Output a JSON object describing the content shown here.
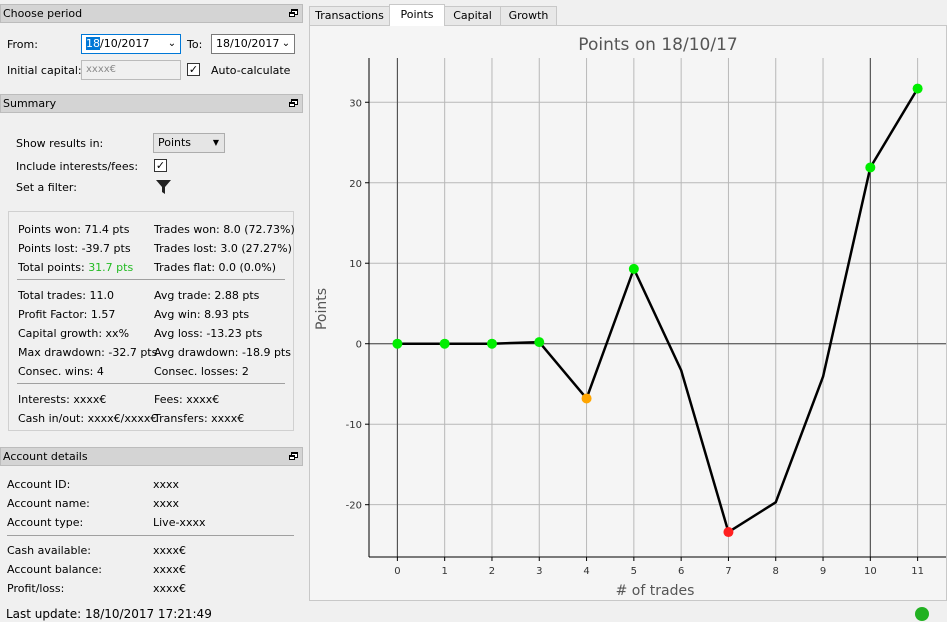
{
  "period": {
    "header": "Choose period",
    "from_label": "From:",
    "from_day": "18",
    "from_rest": "/10/2017",
    "to_label": "To:",
    "to_value": "18/10/2017",
    "capital_label": "Initial capital:",
    "capital_placeholder": "xxxx€",
    "autocalc_label": "Auto-calculate"
  },
  "summary": {
    "header": "Summary",
    "show_results_label": "Show results in:",
    "show_results_value": "Points",
    "include_fees_label": "Include interests/fees:",
    "filter_label": "Set a filter:",
    "stats": {
      "points_won": "Points won: 71.4 pts",
      "trades_won": "Trades won: 8.0 (72.73%)",
      "points_lost": "Points lost: -39.7 pts",
      "trades_lost": "Trades lost: 3.0 (27.27%)",
      "total_points_label": "Total points: ",
      "total_points_value": "31.7 pts",
      "trades_flat": "Trades flat: 0.0 (0.0%)",
      "total_trades": "Total trades: 11.0",
      "avg_trade": "Avg trade: 2.88 pts",
      "profit_factor": "Profit Factor: 1.57",
      "avg_win": "Avg win: 8.93 pts",
      "capital_growth": "Capital growth: xx%",
      "avg_loss": "Avg loss: -13.23 pts",
      "max_drawdown": "Max drawdown: -32.7 pts",
      "avg_drawdown": "Avg drawdown: -18.9 pts",
      "consec_wins": "Consec. wins: 4",
      "consec_losses": "Consec. losses: 2",
      "interests": "Interests: xxxx€",
      "fees": "Fees: xxxx€",
      "cash_inout": "Cash in/out: xxxx€/xxxx€",
      "transfers": "Transfers: xxxx€"
    },
    "total_points_color": "#22bb22"
  },
  "account": {
    "header": "Account details",
    "id_label": "Account ID:",
    "id_value": "xxxx",
    "name_label": "Account name:",
    "name_value": "xxxx",
    "type_label": "Account type:",
    "type_value": "Live-xxxx",
    "cash_label": "Cash available:",
    "cash_value": "xxxx€",
    "balance_label": "Account balance:",
    "balance_value": "xxxx€",
    "pl_label": "Profit/loss:",
    "pl_value": "xxxx€"
  },
  "status": {
    "last_update": "Last update: 18/10/2017 17:21:49",
    "indicator_color": "#22b122"
  },
  "tabs": [
    "Transactions",
    "Points",
    "Capital",
    "Growth"
  ],
  "active_tab": "Points",
  "chart_data": {
    "type": "line",
    "title": "Points on 18/10/17",
    "xlabel": "# of trades",
    "ylabel": "Points",
    "x": [
      0,
      1,
      2,
      3,
      4,
      5,
      6,
      7,
      8,
      9,
      10,
      11
    ],
    "y": [
      0,
      0,
      0,
      0.2,
      -6.8,
      9.3,
      -3.3,
      -23.4,
      -19.7,
      -4.1,
      21.9,
      31.7
    ],
    "markers": [
      {
        "x": 0,
        "color": "#00ee00"
      },
      {
        "x": 1,
        "color": "#00ee00"
      },
      {
        "x": 2,
        "color": "#00ee00"
      },
      {
        "x": 3,
        "color": "#00ee00"
      },
      {
        "x": 4,
        "color": "#ffa500"
      },
      {
        "x": 5,
        "color": "#00ee00"
      },
      {
        "x": 7,
        "color": "#ff2020"
      },
      {
        "x": 10,
        "color": "#00ee00"
      },
      {
        "x": 11,
        "color": "#00ee00"
      }
    ],
    "xlim": [
      -0.6,
      11.6
    ],
    "ylim": [
      -26.5,
      35.5
    ],
    "xticks": [
      0,
      1,
      2,
      3,
      4,
      5,
      6,
      7,
      8,
      9,
      10,
      11
    ],
    "yticks": [
      -20,
      -10,
      0,
      10,
      20,
      30
    ],
    "grid": true,
    "line_color": "#000000"
  }
}
